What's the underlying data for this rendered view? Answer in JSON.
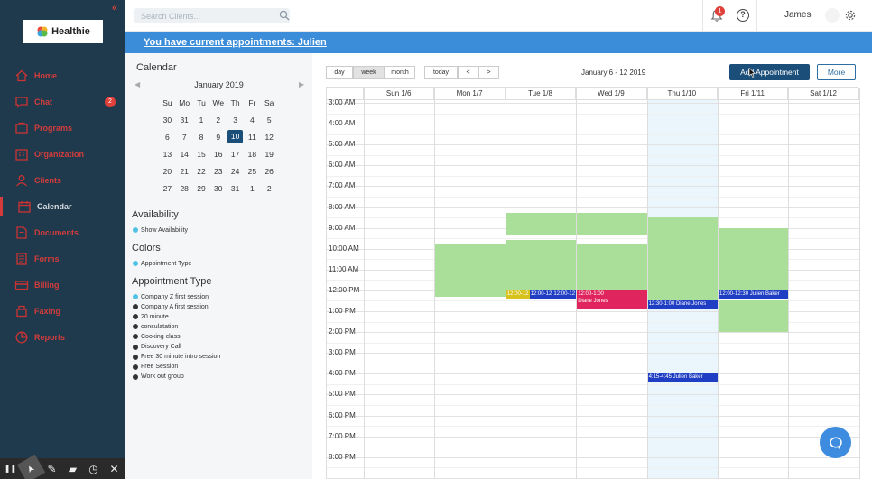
{
  "sidebar": {
    "collapse_glyph": "«",
    "logo_text": "Healthie",
    "items": [
      {
        "label": "Home",
        "icon": "home-icon"
      },
      {
        "label": "Chat",
        "icon": "chat-icon",
        "badge": "2"
      },
      {
        "label": "Programs",
        "icon": "programs-icon"
      },
      {
        "label": "Organization",
        "icon": "organization-icon"
      },
      {
        "label": "Clients",
        "icon": "clients-icon"
      },
      {
        "label": "Calendar",
        "icon": "calendar-icon",
        "active": true
      },
      {
        "label": "Documents",
        "icon": "documents-icon"
      },
      {
        "label": "Forms",
        "icon": "forms-icon"
      },
      {
        "label": "Billing",
        "icon": "billing-icon"
      },
      {
        "label": "Faxing",
        "icon": "faxing-icon"
      },
      {
        "label": "Reports",
        "icon": "reports-icon"
      }
    ],
    "tools": [
      "pause-icon",
      "pointer-icon",
      "pen-icon",
      "eraser-icon",
      "timer-icon",
      "close-icon"
    ]
  },
  "topbar": {
    "search_placeholder": "Search Clients...",
    "notification_count": "1",
    "help_glyph": "?",
    "user_name": "James"
  },
  "banner": {
    "text": "You have current appointments: Julien"
  },
  "left_panel": {
    "calendar_title": "Calendar",
    "month_label": "January 2019",
    "weekday_headers": [
      "Su",
      "Mo",
      "Tu",
      "We",
      "Th",
      "Fr",
      "Sa"
    ],
    "weeks": [
      [
        "30",
        "31",
        "1",
        "2",
        "3",
        "4",
        "5"
      ],
      [
        "6",
        "7",
        "8",
        "9",
        "10",
        "11",
        "12"
      ],
      [
        "13",
        "14",
        "15",
        "16",
        "17",
        "18",
        "19"
      ],
      [
        "20",
        "21",
        "22",
        "23",
        "24",
        "25",
        "26"
      ],
      [
        "27",
        "28",
        "29",
        "30",
        "31",
        "1",
        "2"
      ]
    ],
    "selected_day": "10",
    "availability_title": "Availability",
    "show_availability": "Show Availability",
    "colors_title": "Colors",
    "colors_option": "Appointment Type",
    "appointment_type_title": "Appointment Type",
    "appointment_types": [
      {
        "label": "Company Z first session",
        "color": "#4fc2e6"
      },
      {
        "label": "Company A first session",
        "color": "#333333"
      },
      {
        "label": "20 minute",
        "color": "#333333"
      },
      {
        "label": "consulatation",
        "color": "#333333"
      },
      {
        "label": "Cooking class",
        "color": "#333333"
      },
      {
        "label": "Discovery Call",
        "color": "#333333"
      },
      {
        "label": "Free 30 minute intro session",
        "color": "#333333"
      },
      {
        "label": "Free Session",
        "color": "#333333"
      },
      {
        "label": "Work out group",
        "color": "#333333"
      }
    ]
  },
  "main": {
    "view_buttons": [
      "day",
      "week",
      "month"
    ],
    "active_view": "week",
    "nav_buttons": [
      "today",
      "<",
      ">"
    ],
    "range_label": "January 6 - 12 2019",
    "add_appointment_label": "Add Appointment",
    "more_label": "More",
    "days": [
      "Sun 1/6",
      "Mon 1/7",
      "Tue 1/8",
      "Wed 1/9",
      "Thu 1/10",
      "Fri 1/11",
      "Sat 1/12"
    ],
    "times": [
      "3:00 AM",
      "4:00 AM",
      "5:00 AM",
      "6:00 AM",
      "7:00 AM",
      "8:00 AM",
      "9:00 AM",
      "10:00 AM",
      "11:00 AM",
      "12:00 PM",
      "1:00 PM",
      "2:00 PM",
      "3:00 PM",
      "4:00 PM",
      "5:00 PM",
      "6:00 PM",
      "7:00 PM",
      "8:00 PM"
    ],
    "events": [
      {
        "text": "12:00-12",
        "color": "yellow",
        "day": 2,
        "start": 12.0,
        "end": 12.5,
        "slot": 0
      },
      {
        "text": "12:00-12",
        "color": "navy",
        "day": 2,
        "start": 12.0,
        "end": 12.5,
        "slot": 1
      },
      {
        "text": "12:00-12",
        "color": "navy",
        "day": 2,
        "start": 12.0,
        "end": 12.5,
        "slot": 2
      },
      {
        "text": "12:00-1:00",
        "sub": "Diane Jones",
        "color": "pink",
        "day": 3,
        "start": 12.0,
        "end": 13.0,
        "slot": -1
      },
      {
        "text": "12:30-1:00  Diane Jones",
        "color": "navy",
        "day": 4,
        "start": 12.5,
        "end": 13.0,
        "slot": -1
      },
      {
        "text": "12:00-12:30  Julien Baker",
        "color": "navy",
        "day": 5,
        "start": 12.0,
        "end": 12.5,
        "slot": -1
      },
      {
        "text": "4:15-4:45  Julien Baker",
        "color": "navy",
        "day": 4,
        "start": 16.0,
        "end": 16.5,
        "slot": -1
      }
    ],
    "availability": [
      {
        "day": 1,
        "start": 9.8,
        "end": 12.3
      },
      {
        "day": 2,
        "start": 8.3,
        "end": 9.3
      },
      {
        "day": 2,
        "start": 9.6,
        "end": 12.0
      },
      {
        "day": 3,
        "start": 8.3,
        "end": 9.3
      },
      {
        "day": 3,
        "start": 9.8,
        "end": 12.0
      },
      {
        "day": 4,
        "start": 8.5,
        "end": 12.5
      },
      {
        "day": 5,
        "start": 9.0,
        "end": 12.0
      },
      {
        "day": 5,
        "start": 12.5,
        "end": 14.0
      }
    ],
    "today_index": 4
  }
}
